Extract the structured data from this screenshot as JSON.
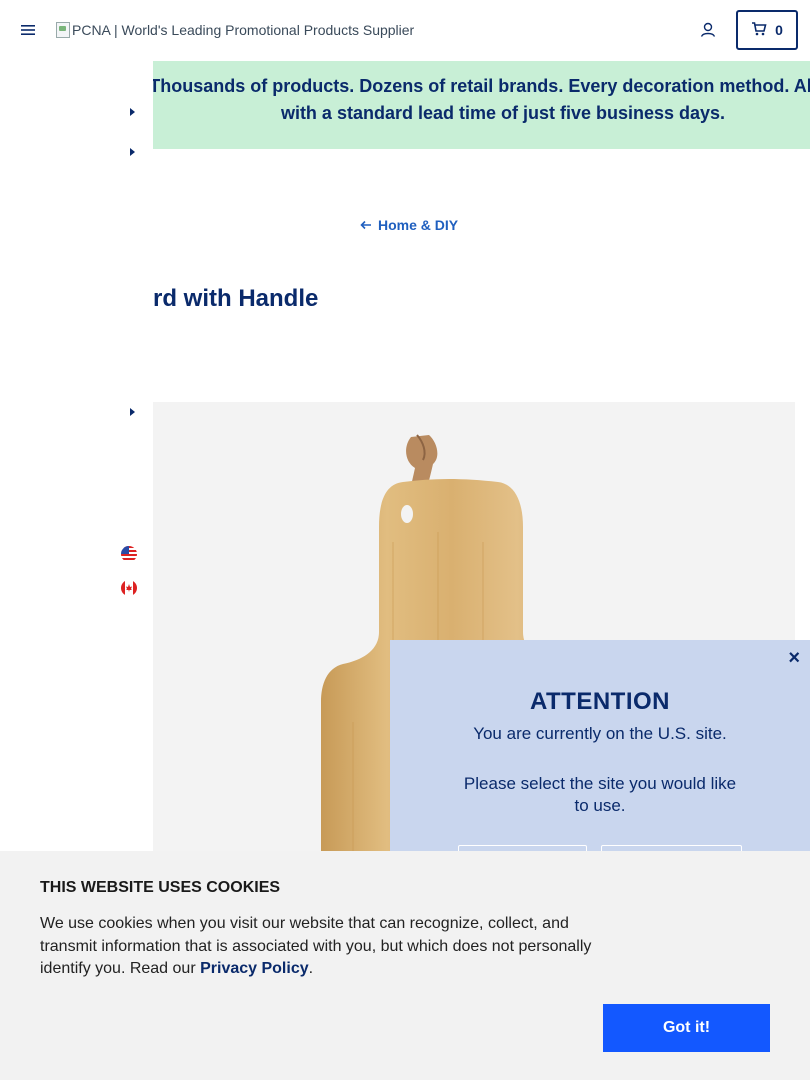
{
  "header": {
    "logo_alt": "PCNA | World's Leading Promotional Products Supplier",
    "cart_count": "0"
  },
  "promo": {
    "line1": "Thousands of products. Dozens of retail brands. Every decoration method. All",
    "line2": "with a standard lead time of just five business days."
  },
  "breadcrumb": {
    "back_label": "Home & DIY"
  },
  "product": {
    "title_visible": "rd with Handle"
  },
  "modal": {
    "title": "ATTENTION",
    "line1": "You are currently on the U.S. site.",
    "line2": "Please select the site you would like to use.",
    "close": "×"
  },
  "cookie": {
    "title": "THIS WEBSITE USES COOKIES",
    "text_before": "We use cookies when you visit our website that can recognize, collect, and transmit information that is associated with you, but which does not personally identify you. Read our ",
    "link": "Privacy Policy",
    "text_after": ".",
    "button": "Got it!"
  },
  "colors": {
    "navy": "#0a2a6b",
    "promo_bg": "#c8efd6",
    "modal_bg": "#c9d6ee",
    "button_blue": "#1358ff",
    "link_blue": "#1f5fbf"
  },
  "icons": [
    "hamburger-menu-icon",
    "account-icon",
    "cart-icon",
    "caret-right-icon",
    "arrow-left-icon",
    "us-flag-icon",
    "canada-flag-icon",
    "close-icon"
  ]
}
